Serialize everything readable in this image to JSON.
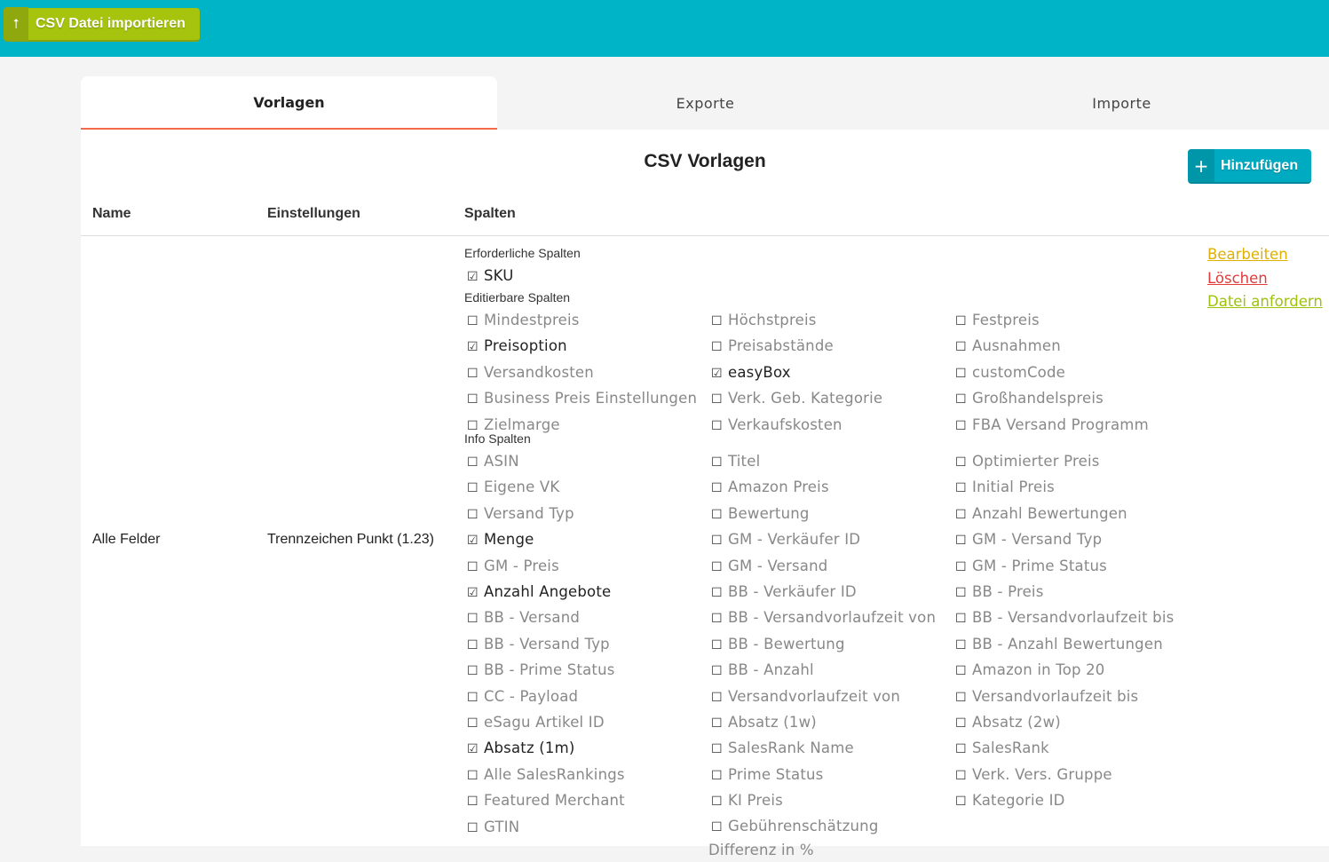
{
  "topbar": {
    "import_label": "CSV Datei importieren",
    "import_icon": "upload-icon"
  },
  "tabs": [
    {
      "label": "Vorlagen",
      "active": true
    },
    {
      "label": "Exporte",
      "active": false
    },
    {
      "label": "Importe",
      "active": false
    }
  ],
  "panel": {
    "title": "CSV Vorlagen",
    "add_label": "Hinzufügen",
    "add_icon": "plus-icon"
  },
  "table": {
    "headers": {
      "name": "Name",
      "settings": "Einstellungen",
      "columns": "Spalten"
    },
    "row": {
      "name": "Alle Felder",
      "settings": "Trennzeichen Punkt (1.23)",
      "required_label": "Erforderliche Spalten",
      "required": [
        {
          "label": "SKU",
          "checked": true
        }
      ],
      "editable_label": "Editierbare Spalten",
      "editable": [
        [
          {
            "label": "Mindestpreis",
            "checked": false
          },
          {
            "label": "Preisoption",
            "checked": true
          },
          {
            "label": "Versandkosten",
            "checked": false
          },
          {
            "label": "Business Preis Einstellungen",
            "checked": false
          },
          {
            "label": "Zielmarge",
            "checked": false
          }
        ],
        [
          {
            "label": "Höchstpreis",
            "checked": false
          },
          {
            "label": "Preisabstände",
            "checked": false
          },
          {
            "label": "easyBox",
            "checked": true
          },
          {
            "label": "Verk. Geb. Kategorie",
            "checked": false
          },
          {
            "label": "Verkaufskosten",
            "checked": false
          }
        ],
        [
          {
            "label": "Festpreis",
            "checked": false
          },
          {
            "label": "Ausnahmen",
            "checked": false
          },
          {
            "label": "customCode",
            "checked": false
          },
          {
            "label": "Großhandelspreis",
            "checked": false
          },
          {
            "label": "FBA Versand Programm",
            "checked": false
          }
        ]
      ],
      "info_label": "Info Spalten",
      "info": [
        [
          {
            "label": "ASIN",
            "checked": false
          },
          {
            "label": "Eigene VK",
            "checked": false
          },
          {
            "label": "Versand Typ",
            "checked": false
          },
          {
            "label": "Menge",
            "checked": true
          },
          {
            "label": "GM - Preis",
            "checked": false
          },
          {
            "label": "Anzahl Angebote",
            "checked": true
          },
          {
            "label": "BB - Versand",
            "checked": false
          },
          {
            "label": "BB - Versand Typ",
            "checked": false
          },
          {
            "label": "BB - Prime Status",
            "checked": false
          },
          {
            "label": "CC - Payload",
            "checked": false
          },
          {
            "label": "eSagu Artikel ID",
            "checked": false
          },
          {
            "label": "Absatz (1m)",
            "checked": true
          },
          {
            "label": "Alle SalesRankings",
            "checked": false
          },
          {
            "label": "Featured Merchant",
            "checked": false
          },
          {
            "label": "GTIN",
            "checked": false
          }
        ],
        [
          {
            "label": "Titel",
            "checked": false
          },
          {
            "label": "Amazon Preis",
            "checked": false
          },
          {
            "label": "Bewertung",
            "checked": false
          },
          {
            "label": "GM - Verkäufer ID",
            "checked": false
          },
          {
            "label": "GM - Versand",
            "checked": false
          },
          {
            "label": "BB - Verkäufer ID",
            "checked": false
          },
          {
            "label": "BB - Versandvorlaufzeit von",
            "checked": false
          },
          {
            "label": "BB - Bewertung",
            "checked": false
          },
          {
            "label": "BB - Anzahl",
            "checked": false
          },
          {
            "label": "Versandvorlaufzeit von",
            "checked": false
          },
          {
            "label": "Absatz (1w)",
            "checked": false
          },
          {
            "label": "SalesRank Name",
            "checked": false
          },
          {
            "label": "Prime Status",
            "checked": false
          },
          {
            "label": "KI Preis",
            "checked": false
          },
          {
            "label": "Gebührenschätzung Differenz in %",
            "checked": false
          }
        ],
        [
          {
            "label": "Optimierter Preis",
            "checked": false
          },
          {
            "label": "Initial Preis",
            "checked": false
          },
          {
            "label": "Anzahl Bewertungen",
            "checked": false
          },
          {
            "label": "GM - Versand Typ",
            "checked": false
          },
          {
            "label": "GM - Prime Status",
            "checked": false
          },
          {
            "label": "BB - Preis",
            "checked": false
          },
          {
            "label": "BB - Versandvorlaufzeit bis",
            "checked": false
          },
          {
            "label": "BB - Anzahl Bewertungen",
            "checked": false
          },
          {
            "label": "Amazon in Top 20",
            "checked": false
          },
          {
            "label": "Versandvorlaufzeit bis",
            "checked": false
          },
          {
            "label": "Absatz (2w)",
            "checked": false
          },
          {
            "label": "SalesRank",
            "checked": false
          },
          {
            "label": "Verk. Vers. Gruppe",
            "checked": false
          },
          {
            "label": "Kategorie ID",
            "checked": false
          }
        ]
      ],
      "actions": {
        "edit": "Bearbeiten",
        "delete": "Löschen",
        "request": "Datei anfordern"
      }
    }
  },
  "colors": {
    "topbar": "#00b4c8",
    "import_button": "#a6c30e",
    "add_button": "#00aac0",
    "tab_accent": "#f26a4b",
    "edit": "#e0b000",
    "delete": "#e03a3a",
    "request": "#9cc20a"
  }
}
